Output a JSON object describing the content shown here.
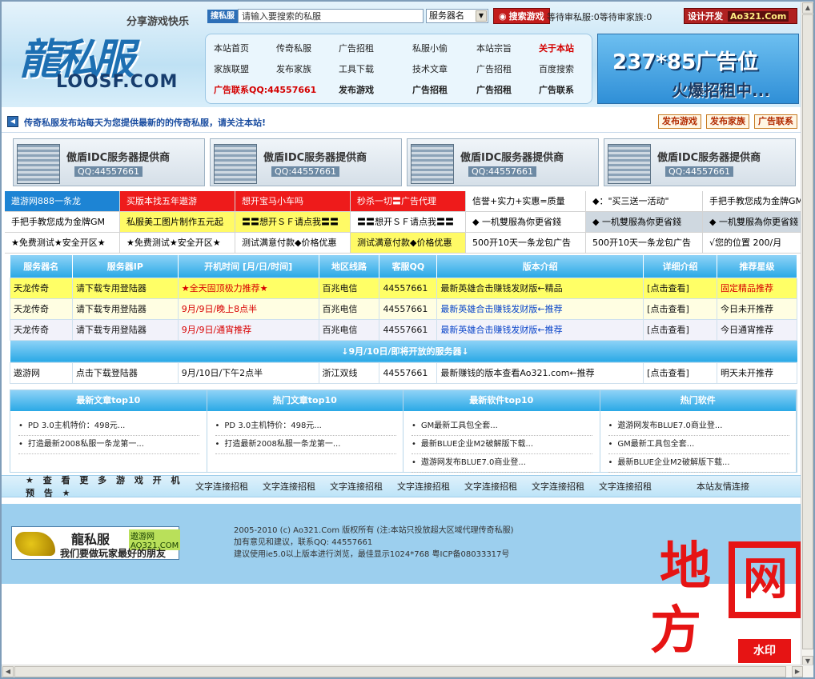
{
  "header": {
    "slogan": "分享游戏快乐",
    "logo_text": "龍私服",
    "logo_domain": "LOOSF.COM",
    "search_label": "搜私服",
    "search_placeholder": "请输入要搜索的私服",
    "server_select": "服务器名",
    "search_button": "搜索游戏",
    "status": "等待审私服:0等待审家族:0",
    "design_label": "设计开发",
    "design_domain": "Ao321.Com",
    "nav": [
      {
        "label": "本站首页",
        "style": ""
      },
      {
        "label": "传奇私服",
        "style": ""
      },
      {
        "label": "广告招租",
        "style": ""
      },
      {
        "label": "私服小偷",
        "style": ""
      },
      {
        "label": "本站宗旨",
        "style": ""
      },
      {
        "label": "关于本站",
        "style": "red"
      },
      {
        "label": "家族联盟",
        "style": ""
      },
      {
        "label": "发布家族",
        "style": ""
      },
      {
        "label": "工具下载",
        "style": ""
      },
      {
        "label": "技术文章",
        "style": ""
      },
      {
        "label": "广告招租",
        "style": ""
      },
      {
        "label": "百度搜索",
        "style": ""
      },
      {
        "label": "广告联系QQ:44557661",
        "style": "red"
      },
      {
        "label": "",
        "style": ""
      },
      {
        "label": "发布游戏",
        "style": "bold"
      },
      {
        "label": "广告招租",
        "style": "bold"
      },
      {
        "label": "广告招租",
        "style": "bold"
      },
      {
        "label": "广告联系",
        "style": "bold"
      }
    ],
    "banner_big": "237*85广告位",
    "banner_sub": "火爆招租中..."
  },
  "notice": {
    "text": "传奇私服发布站每天为您提供最新的的传奇私服，请关注本站!",
    "buttons": [
      "发布游戏",
      "发布家族",
      "广告联系"
    ]
  },
  "idc_ads": [
    {
      "title": "傲盾IDC服务器提供商",
      "qq": "QQ:44557661"
    },
    {
      "title": "傲盾IDC服务器提供商",
      "qq": "QQ:44557661"
    },
    {
      "title": "傲盾IDC服务器提供商",
      "qq": "QQ:44557661"
    },
    {
      "title": "傲盾IDC服务器提供商",
      "qq": "QQ:44557661"
    }
  ],
  "link_rows": [
    [
      {
        "text": "遨游网888一条龙",
        "color": "blue"
      },
      {
        "text": "买版本找五年遨游",
        "color": "red"
      },
      {
        "text": "想开宝马小车吗",
        "color": "red"
      },
      {
        "text": "秒杀一切〓广告代理",
        "color": "red"
      },
      {
        "text": "信誉+实力+实惠=质量",
        "color": "white"
      },
      {
        "text": "◆：\"买三送一活动\"",
        "color": "white"
      },
      {
        "text": "手把手教您成为金牌GM",
        "color": "white"
      }
    ],
    [
      {
        "text": "手把手教您成为金牌GM",
        "color": "white"
      },
      {
        "text": "私服美工图片制作五元起",
        "color": "yellow"
      },
      {
        "text": "〓〓想开ＳＦ请点我〓〓",
        "color": "yellow"
      },
      {
        "text": "〓〓想开ＳＦ请点我〓〓",
        "color": "white"
      },
      {
        "text": "◆ 一机雙服為你更省錢",
        "color": "white"
      },
      {
        "text": "◆ 一机雙服為你更省錢",
        "color": "gray"
      },
      {
        "text": "◆ 一机雙服為你更省錢",
        "color": "gray"
      }
    ],
    [
      {
        "text": "★免费测试★安全开区★",
        "color": "white"
      },
      {
        "text": "★免费测试★安全开区★",
        "color": "white"
      },
      {
        "text": "测试满意付款◆价格优惠",
        "color": "white"
      },
      {
        "text": "测试满意付款◆价格优惠",
        "color": "yellow"
      },
      {
        "text": "500开10天一条龙包广告",
        "color": "white"
      },
      {
        "text": "500开10天一条龙包广告",
        "color": "white"
      },
      {
        "text": "√您的位置 200/月",
        "color": "white"
      }
    ]
  ],
  "table": {
    "headers": [
      "服务器名",
      "服务器IP",
      "开机时间 [月/日/时间]",
      "地区线路",
      "客服QQ",
      "版本介绍",
      "详细介绍",
      "推荐星级"
    ],
    "rows": [
      {
        "style": "yel",
        "cells": [
          "天龙传奇",
          "请下载专用登陆器",
          "★全天固顶极力推荐★",
          "百兆电信",
          "44557661",
          "最新英雄合击赚钱发财版←精品",
          "[点击查看]",
          "固定精品推荐"
        ]
      },
      {
        "style": "lyel",
        "cells": [
          "天龙传奇",
          "请下载专用登陆器",
          "9月/9日/晚上8点半",
          "百兆电信",
          "44557661",
          "最新英雄合击赚钱发财版←推荐",
          "[点击查看]",
          "今日未开推荐"
        ]
      },
      {
        "style": "gray",
        "cells": [
          "天龙传奇",
          "请下载专用登陆器",
          "9月/9日/通宵推荐",
          "百兆电信",
          "44557661",
          "最新英雄合击赚钱发财版←推荐",
          "[点击查看]",
          "今日通宵推荐"
        ]
      }
    ],
    "separator": "↓9月/10日/即将开放的服务器↓",
    "upcoming": [
      "遨游网",
      "点击下载登陆器",
      "9月/10日/下午2点半",
      "浙江双线",
      "44557661",
      "最新赚钱的版本查看Ao321.com←推荐",
      "[点击查看]",
      "明天未开推荐"
    ]
  },
  "tops": [
    {
      "title": "最新文章top10",
      "items": [
        "PD 3.0主机特价：498元...",
        "打造最新2008私服一条龙第一..."
      ]
    },
    {
      "title": "热门文章top10",
      "items": [
        "PD 3.0主机特价：498元...",
        "打造最新2008私服一条龙第一..."
      ]
    },
    {
      "title": "最新软件top10",
      "items": [
        "GM最新工具包全套...",
        "最新BLUE企业M2破解版下载...",
        "遨游网发布BLUE7.0商业登..."
      ]
    },
    {
      "title": "热门软件",
      "items": [
        "遨游网发布BLUE7.0商业登...",
        "GM最新工具包全套...",
        "最新BLUE企业M2破解版下载..."
      ]
    }
  ],
  "more_bar": {
    "title": "★ 查 看 更 多 游 戏 开 机 预 告 ★",
    "links": [
      "文字连接招租",
      "文字连接招租",
      "文字连接招租",
      "文字连接招租",
      "文字连接招租",
      "文字连接招租",
      "文字连接招租"
    ],
    "end": "本站友情连接"
  },
  "footer": {
    "logo_title": "龍私服",
    "logo_site": "遨游网 AO321.COM",
    "logo_slogan": "我们要做玩家最好的朋友",
    "lines": [
      "2005-2010 (c) Ao321.Com 版权所有 (注:本站只投放超大区域代理传奇私服)",
      "加有意见和建议，联系QQ: 44557661",
      "建议使用ie5.0以上版本进行浏览，最佳显示1024*768 粤ICP备08033317号"
    ]
  },
  "watermark": {
    "c1": "地",
    "c2": "方",
    "c3": "网",
    "stamp": "水印"
  }
}
